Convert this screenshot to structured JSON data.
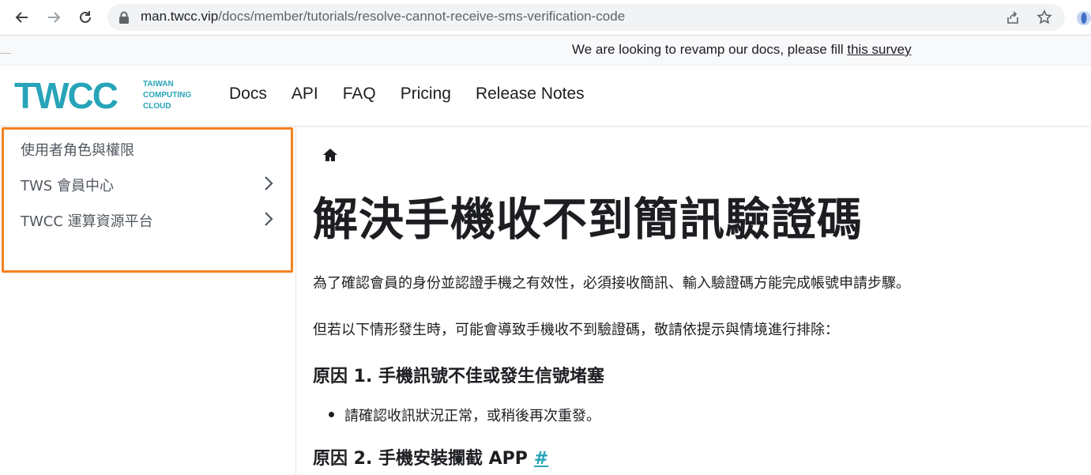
{
  "browser": {
    "url_domain": "man.twcc.vip",
    "url_path": "/docs/member/tutorials/resolve-cannot-receive-sms-verification-code"
  },
  "announcement": {
    "text": "We are looking to revamp our docs, please fill ",
    "link": "this survey"
  },
  "logo": {
    "word": "TWCC",
    "sub_line1": "TAIWAN",
    "sub_line2": "COMPUTING",
    "sub_line3": "CLOUD",
    "color": "#27a4b8"
  },
  "navbar": {
    "items": [
      "Docs",
      "API",
      "FAQ",
      "Pricing",
      "Release Notes"
    ]
  },
  "sidebar": {
    "highlight_color": "#f58220",
    "items": [
      {
        "label": "使用者角色與權限"
      },
      {
        "label": "TWS 會員中心"
      },
      {
        "label": "TWCC 運算資源平台"
      }
    ]
  },
  "content": {
    "title": "解決手機收不到簡訊驗證碼",
    "intro1": "為了確認會員的身份並認證手機之有效性，必須接收簡訊、輸入驗證碼方能完成帳號申請步驟。",
    "intro2": "但若以下情形發生時，可能會導致手機收不到驗證碼，敬請依提示與情境進行排除：",
    "reason1_title": "原因 1. 手機訊號不佳或發生信號堵塞",
    "reason1_bullet": "請確認收訊狀況正常，或稍後再次重發。",
    "reason2_title": "原因 2. 手機安裝攔截 APP",
    "anchor_symbol": "#"
  }
}
